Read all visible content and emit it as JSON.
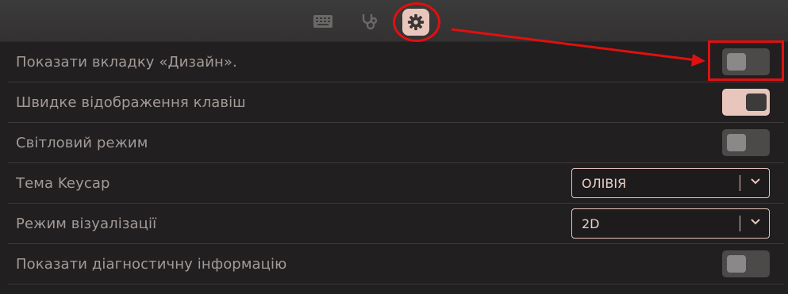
{
  "tabs": [
    {
      "name": "keyboard-icon"
    },
    {
      "name": "stethoscope-icon"
    },
    {
      "name": "gear-icon",
      "active": true
    }
  ],
  "settings": {
    "show_design_tab": {
      "label": "Показати вкладку «Дизайн».",
      "enabled": false
    },
    "quick_key_display": {
      "label": "Швидке відображення клавіш",
      "enabled": true
    },
    "light_mode": {
      "label": "Світловий режим",
      "enabled": false
    },
    "keycap_theme": {
      "label": "Тема Keycap",
      "value": "ОЛІВІЯ"
    },
    "render_mode": {
      "label": "Режим візуалізації",
      "value": "2D"
    },
    "show_diagnostics": {
      "label": "Показати діагностичну інформацію",
      "enabled": false
    }
  },
  "colors": {
    "background": "#211f1f",
    "accent": "#e9c6bc",
    "annotation": "#e01010"
  }
}
